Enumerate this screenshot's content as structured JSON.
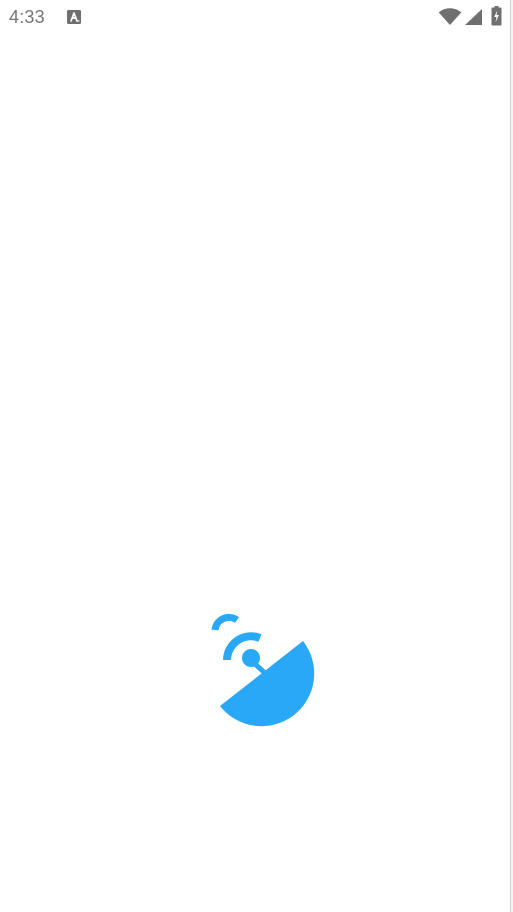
{
  "status_bar": {
    "time": "4:33",
    "notification_icon": "text-a-icon",
    "wifi_icon": "wifi-icon",
    "cell_icon": "cell-signal-icon",
    "battery_icon": "battery-charging-icon"
  },
  "splash": {
    "logo_icon": "satellite-dish-icon",
    "logo_color": "#29A8F7"
  },
  "colors": {
    "status_icons": "#6f6f6f",
    "background": "#ffffff"
  }
}
